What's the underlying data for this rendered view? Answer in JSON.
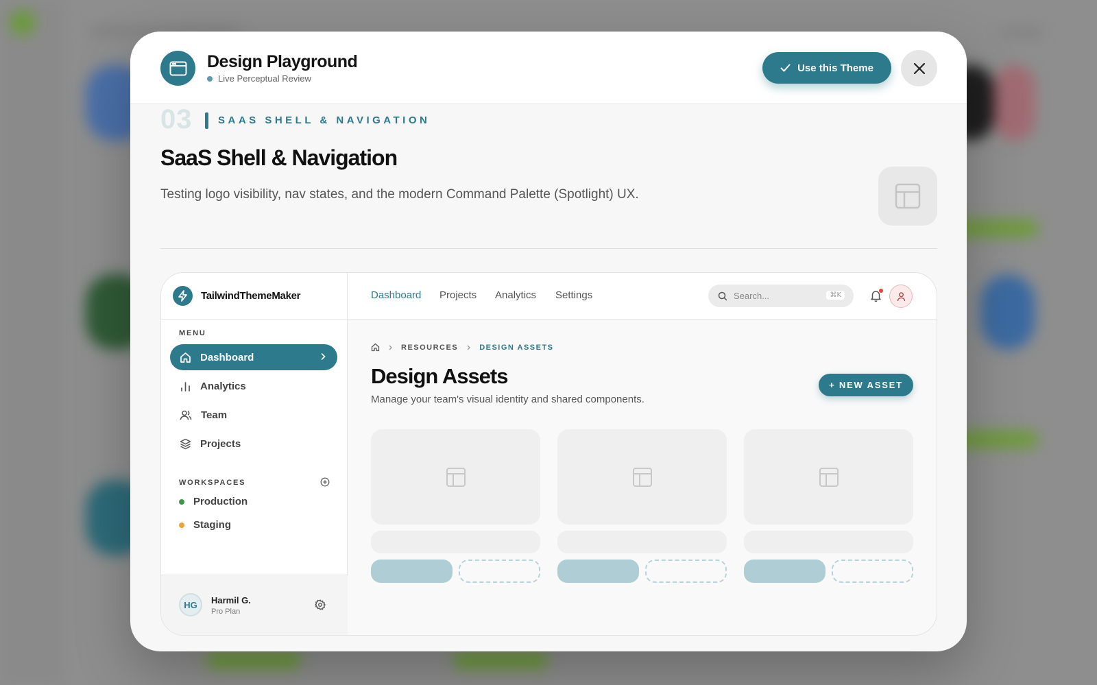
{
  "modal": {
    "title": "Design Playground",
    "subtitle": "Live Perceptual Review",
    "use_theme_label": "Use this Theme",
    "icons": {
      "header": "browser-window-icon",
      "check": "check-icon",
      "close": "close-icon"
    }
  },
  "section": {
    "number": "03",
    "eyebrow": "SAAS SHELL & NAVIGATION",
    "title": "SaaS Shell & Navigation",
    "description": "Testing logo visibility, nav states, and the modern Command Palette (Spotlight) UX.",
    "icon": "layout-icon"
  },
  "app": {
    "brand": "TailwindThemeMaker",
    "brand_icon": "lightning-icon",
    "menu_label": "MENU",
    "nav": [
      {
        "label": "Dashboard",
        "icon": "home-icon",
        "active": true
      },
      {
        "label": "Analytics",
        "icon": "bar-chart-icon",
        "active": false
      },
      {
        "label": "Team",
        "icon": "users-icon",
        "active": false
      },
      {
        "label": "Projects",
        "icon": "layers-icon",
        "active": false
      }
    ],
    "workspaces_label": "WORKSPACES",
    "workspaces": [
      {
        "label": "Production",
        "color": "#3e9a4a"
      },
      {
        "label": "Staging",
        "color": "#f0a23a"
      }
    ],
    "user": {
      "initials": "HG",
      "name": "Harmil G.",
      "plan": "Pro Plan"
    },
    "topnav": [
      {
        "label": "Dashboard",
        "active": true
      },
      {
        "label": "Projects",
        "active": false
      },
      {
        "label": "Analytics",
        "active": false
      },
      {
        "label": "Settings",
        "active": false
      }
    ],
    "search": {
      "placeholder": "Search...",
      "shortcut": "⌘K"
    },
    "breadcrumbs": [
      "RESOURCES",
      "DESIGN ASSETS"
    ],
    "page_title": "Design Assets",
    "page_subtitle": "Manage your team's visual identity and shared components.",
    "new_asset_label": "+ NEW ASSET"
  },
  "colors": {
    "accent": "#2c7a8c",
    "accent_soft": "#aecdd5",
    "notification": "#e0443a"
  }
}
